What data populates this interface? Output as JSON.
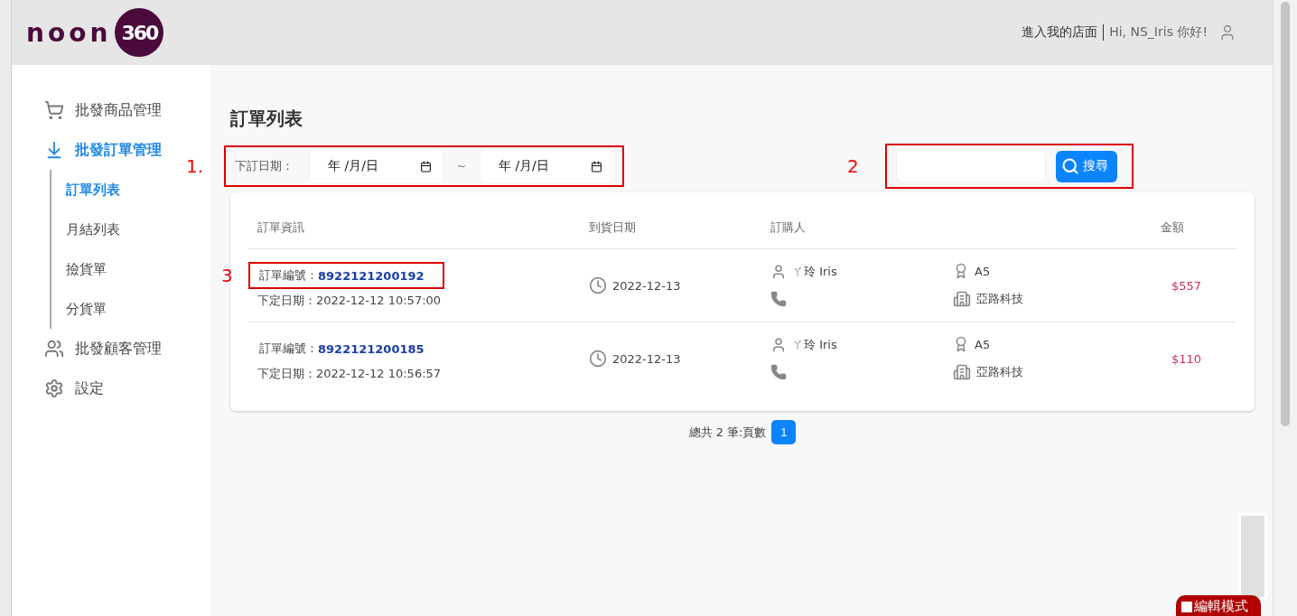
{
  "header": {
    "logo": {
      "word": "noon",
      "badge": "360"
    },
    "store_link": "進入我的店面",
    "greeting": "Hi, NS_Iris 你好!"
  },
  "sidebar": {
    "items": [
      {
        "label": "批發商品管理",
        "kind": "cart",
        "selected": false
      },
      {
        "label": "批發訂單管理",
        "kind": "inbox",
        "selected": true,
        "expanded": true,
        "children": [
          {
            "label": "訂單列表",
            "selected": true
          },
          {
            "label": "月結列表",
            "selected": false
          },
          {
            "label": "撿貨單",
            "selected": false
          },
          {
            "label": "分貨單",
            "selected": false
          }
        ]
      },
      {
        "label": "批發顧客管理",
        "kind": "people",
        "selected": false
      },
      {
        "label": "設定",
        "kind": "gear",
        "selected": false
      }
    ]
  },
  "page_title": "訂單列表",
  "filter": {
    "label": "下訂日期：",
    "from_placeholder": "年 /月/日",
    "separator": "~",
    "to_placeholder": "年 /月/日",
    "annotation": "1."
  },
  "search": {
    "button": "搜尋",
    "annotation": "2"
  },
  "table": {
    "columns": [
      "訂單資訊",
      "到貨日期",
      "訂購人",
      "",
      "金額"
    ],
    "rows": [
      {
        "order_label": "訂單編號：",
        "order_no": "8922121200192",
        "placed_label": "下定日期：",
        "placed": "2022-12-12 10:57:00",
        "arrival": "2022-12-13",
        "buyer": "ㄚ玲 Iris",
        "level": "A5",
        "company": "亞路科技",
        "amount": "$557",
        "annotation": "3"
      },
      {
        "order_label": "訂單編號：",
        "order_no": "8922121200185",
        "placed_label": "下定日期：",
        "placed": "2022-12-12 10:56:57",
        "arrival": "2022-12-13",
        "buyer": "ㄚ玲 Iris",
        "level": "A5",
        "company": "亞路科技",
        "amount": "$110"
      }
    ]
  },
  "pagination": {
    "summary": "總共 2 筆:頁數",
    "pages": [
      {
        "label": "1",
        "selected": true
      }
    ]
  },
  "edit_mode": {
    "label": "編輯模式",
    "checked": false
  }
}
